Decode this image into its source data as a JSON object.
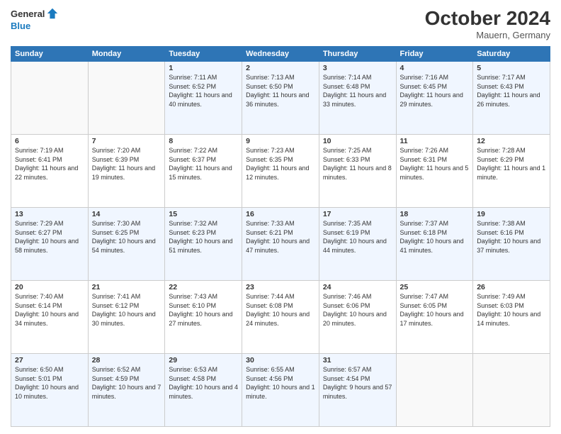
{
  "header": {
    "logo_general": "General",
    "logo_blue": "Blue",
    "title": "October 2024",
    "location": "Mauern, Germany"
  },
  "days_of_week": [
    "Sunday",
    "Monday",
    "Tuesday",
    "Wednesday",
    "Thursday",
    "Friday",
    "Saturday"
  ],
  "weeks": [
    [
      {
        "day": "",
        "sunrise": "",
        "sunset": "",
        "daylight": ""
      },
      {
        "day": "",
        "sunrise": "",
        "sunset": "",
        "daylight": ""
      },
      {
        "day": "1",
        "sunrise": "Sunrise: 7:11 AM",
        "sunset": "Sunset: 6:52 PM",
        "daylight": "Daylight: 11 hours and 40 minutes."
      },
      {
        "day": "2",
        "sunrise": "Sunrise: 7:13 AM",
        "sunset": "Sunset: 6:50 PM",
        "daylight": "Daylight: 11 hours and 36 minutes."
      },
      {
        "day": "3",
        "sunrise": "Sunrise: 7:14 AM",
        "sunset": "Sunset: 6:48 PM",
        "daylight": "Daylight: 11 hours and 33 minutes."
      },
      {
        "day": "4",
        "sunrise": "Sunrise: 7:16 AM",
        "sunset": "Sunset: 6:45 PM",
        "daylight": "Daylight: 11 hours and 29 minutes."
      },
      {
        "day": "5",
        "sunrise": "Sunrise: 7:17 AM",
        "sunset": "Sunset: 6:43 PM",
        "daylight": "Daylight: 11 hours and 26 minutes."
      }
    ],
    [
      {
        "day": "6",
        "sunrise": "Sunrise: 7:19 AM",
        "sunset": "Sunset: 6:41 PM",
        "daylight": "Daylight: 11 hours and 22 minutes."
      },
      {
        "day": "7",
        "sunrise": "Sunrise: 7:20 AM",
        "sunset": "Sunset: 6:39 PM",
        "daylight": "Daylight: 11 hours and 19 minutes."
      },
      {
        "day": "8",
        "sunrise": "Sunrise: 7:22 AM",
        "sunset": "Sunset: 6:37 PM",
        "daylight": "Daylight: 11 hours and 15 minutes."
      },
      {
        "day": "9",
        "sunrise": "Sunrise: 7:23 AM",
        "sunset": "Sunset: 6:35 PM",
        "daylight": "Daylight: 11 hours and 12 minutes."
      },
      {
        "day": "10",
        "sunrise": "Sunrise: 7:25 AM",
        "sunset": "Sunset: 6:33 PM",
        "daylight": "Daylight: 11 hours and 8 minutes."
      },
      {
        "day": "11",
        "sunrise": "Sunrise: 7:26 AM",
        "sunset": "Sunset: 6:31 PM",
        "daylight": "Daylight: 11 hours and 5 minutes."
      },
      {
        "day": "12",
        "sunrise": "Sunrise: 7:28 AM",
        "sunset": "Sunset: 6:29 PM",
        "daylight": "Daylight: 11 hours and 1 minute."
      }
    ],
    [
      {
        "day": "13",
        "sunrise": "Sunrise: 7:29 AM",
        "sunset": "Sunset: 6:27 PM",
        "daylight": "Daylight: 10 hours and 58 minutes."
      },
      {
        "day": "14",
        "sunrise": "Sunrise: 7:30 AM",
        "sunset": "Sunset: 6:25 PM",
        "daylight": "Daylight: 10 hours and 54 minutes."
      },
      {
        "day": "15",
        "sunrise": "Sunrise: 7:32 AM",
        "sunset": "Sunset: 6:23 PM",
        "daylight": "Daylight: 10 hours and 51 minutes."
      },
      {
        "day": "16",
        "sunrise": "Sunrise: 7:33 AM",
        "sunset": "Sunset: 6:21 PM",
        "daylight": "Daylight: 10 hours and 47 minutes."
      },
      {
        "day": "17",
        "sunrise": "Sunrise: 7:35 AM",
        "sunset": "Sunset: 6:19 PM",
        "daylight": "Daylight: 10 hours and 44 minutes."
      },
      {
        "day": "18",
        "sunrise": "Sunrise: 7:37 AM",
        "sunset": "Sunset: 6:18 PM",
        "daylight": "Daylight: 10 hours and 41 minutes."
      },
      {
        "day": "19",
        "sunrise": "Sunrise: 7:38 AM",
        "sunset": "Sunset: 6:16 PM",
        "daylight": "Daylight: 10 hours and 37 minutes."
      }
    ],
    [
      {
        "day": "20",
        "sunrise": "Sunrise: 7:40 AM",
        "sunset": "Sunset: 6:14 PM",
        "daylight": "Daylight: 10 hours and 34 minutes."
      },
      {
        "day": "21",
        "sunrise": "Sunrise: 7:41 AM",
        "sunset": "Sunset: 6:12 PM",
        "daylight": "Daylight: 10 hours and 30 minutes."
      },
      {
        "day": "22",
        "sunrise": "Sunrise: 7:43 AM",
        "sunset": "Sunset: 6:10 PM",
        "daylight": "Daylight: 10 hours and 27 minutes."
      },
      {
        "day": "23",
        "sunrise": "Sunrise: 7:44 AM",
        "sunset": "Sunset: 6:08 PM",
        "daylight": "Daylight: 10 hours and 24 minutes."
      },
      {
        "day": "24",
        "sunrise": "Sunrise: 7:46 AM",
        "sunset": "Sunset: 6:06 PM",
        "daylight": "Daylight: 10 hours and 20 minutes."
      },
      {
        "day": "25",
        "sunrise": "Sunrise: 7:47 AM",
        "sunset": "Sunset: 6:05 PM",
        "daylight": "Daylight: 10 hours and 17 minutes."
      },
      {
        "day": "26",
        "sunrise": "Sunrise: 7:49 AM",
        "sunset": "Sunset: 6:03 PM",
        "daylight": "Daylight: 10 hours and 14 minutes."
      }
    ],
    [
      {
        "day": "27",
        "sunrise": "Sunrise: 6:50 AM",
        "sunset": "Sunset: 5:01 PM",
        "daylight": "Daylight: 10 hours and 10 minutes."
      },
      {
        "day": "28",
        "sunrise": "Sunrise: 6:52 AM",
        "sunset": "Sunset: 4:59 PM",
        "daylight": "Daylight: 10 hours and 7 minutes."
      },
      {
        "day": "29",
        "sunrise": "Sunrise: 6:53 AM",
        "sunset": "Sunset: 4:58 PM",
        "daylight": "Daylight: 10 hours and 4 minutes."
      },
      {
        "day": "30",
        "sunrise": "Sunrise: 6:55 AM",
        "sunset": "Sunset: 4:56 PM",
        "daylight": "Daylight: 10 hours and 1 minute."
      },
      {
        "day": "31",
        "sunrise": "Sunrise: 6:57 AM",
        "sunset": "Sunset: 4:54 PM",
        "daylight": "Daylight: 9 hours and 57 minutes."
      },
      {
        "day": "",
        "sunrise": "",
        "sunset": "",
        "daylight": ""
      },
      {
        "day": "",
        "sunrise": "",
        "sunset": "",
        "daylight": ""
      }
    ]
  ]
}
